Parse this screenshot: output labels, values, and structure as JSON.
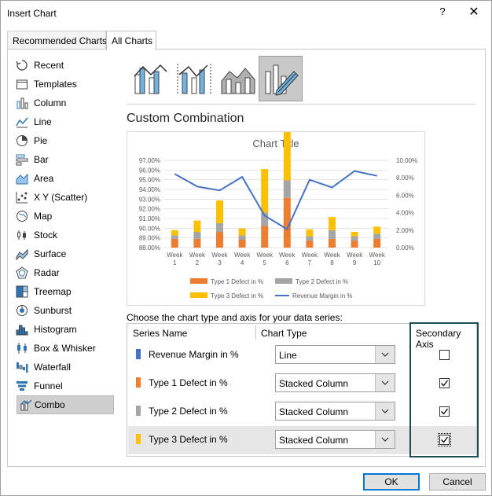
{
  "window": {
    "title": "Insert Chart",
    "help": "?",
    "close": "✕"
  },
  "tabs": [
    {
      "label": "Recommended Charts"
    },
    {
      "label": "All Charts"
    }
  ],
  "sidebar": {
    "items": [
      {
        "label": "Recent",
        "icon": "recent-icon"
      },
      {
        "label": "Templates",
        "icon": "templates-icon"
      },
      {
        "label": "Column",
        "icon": "column-icon"
      },
      {
        "label": "Line",
        "icon": "line-icon"
      },
      {
        "label": "Pie",
        "icon": "pie-icon"
      },
      {
        "label": "Bar",
        "icon": "bar-icon"
      },
      {
        "label": "Area",
        "icon": "area-icon"
      },
      {
        "label": "X Y (Scatter)",
        "icon": "scatter-icon"
      },
      {
        "label": "Map",
        "icon": "map-icon"
      },
      {
        "label": "Stock",
        "icon": "stock-icon"
      },
      {
        "label": "Surface",
        "icon": "surface-icon"
      },
      {
        "label": "Radar",
        "icon": "radar-icon"
      },
      {
        "label": "Treemap",
        "icon": "treemap-icon"
      },
      {
        "label": "Sunburst",
        "icon": "sunburst-icon"
      },
      {
        "label": "Histogram",
        "icon": "histogram-icon"
      },
      {
        "label": "Box & Whisker",
        "icon": "box-whisker-icon"
      },
      {
        "label": "Waterfall",
        "icon": "waterfall-icon"
      },
      {
        "label": "Funnel",
        "icon": "funnel-icon"
      },
      {
        "label": "Combo",
        "icon": "combo-icon",
        "selected": true
      }
    ]
  },
  "main": {
    "heading": "Custom Combination",
    "choose_label": "Choose the chart type and axis for your data series:"
  },
  "chart_data": {
    "type": "bar",
    "title": "Chart Title",
    "categories": [
      "Week 1",
      "Week 2",
      "Week 3",
      "Week 4",
      "Week 5",
      "Week 6",
      "Week 7",
      "Week 8",
      "Week 9",
      "Week 10"
    ],
    "primary_axis_ticks": [
      "97.00%",
      "96.00%",
      "95.00%",
      "94.00%",
      "93.00%",
      "92.00%",
      "91.00%",
      "90.00%",
      "89.00%",
      "88.00%"
    ],
    "secondary_axis_ticks": [
      "10.00%",
      "8.00%",
      "6.00%",
      "4.00%",
      "2.00%",
      "0.00%"
    ],
    "ylim": [
      88,
      97
    ],
    "y2lim": [
      0,
      10
    ],
    "series": [
      {
        "name": "Type 1 Defect in %",
        "kind": "stacked-column",
        "axis": "secondary",
        "color": "#ED7D31",
        "values": [
          1.0,
          1.0,
          1.8,
          0.9,
          2.5,
          5.7,
          0.8,
          1.0,
          0.8,
          1.0
        ]
      },
      {
        "name": "Type 2 Defect in %",
        "kind": "stacked-column",
        "axis": "secondary",
        "color": "#A5A5A5",
        "values": [
          0.4,
          0.8,
          1.0,
          0.5,
          1.5,
          2.0,
          0.5,
          1.0,
          0.5,
          0.6
        ]
      },
      {
        "name": "Type 3 Defect in %",
        "kind": "stacked-column",
        "axis": "secondary",
        "color": "#FFC000",
        "values": [
          0.6,
          1.3,
          2.6,
          0.8,
          5.0,
          6.6,
          0.8,
          1.5,
          0.5,
          0.8
        ]
      },
      {
        "name": "Revenue Margin in %",
        "kind": "line",
        "axis": "primary",
        "color": "#4472C4",
        "values": [
          95.6,
          94.3,
          93.9,
          95.3,
          91.3,
          89.9,
          95.0,
          94.2,
          95.9,
          95.4
        ]
      }
    ],
    "legend": "bottom"
  },
  "series_table": {
    "headers": {
      "name": "Series Name",
      "type": "Chart Type",
      "axis": "Secondary Axis"
    },
    "rows": [
      {
        "name": "Revenue Margin in %",
        "color": "#4472C4",
        "chart_type": "Line",
        "secondary": false
      },
      {
        "name": "Type 1 Defect in %",
        "color": "#ED7D31",
        "chart_type": "Stacked Column",
        "secondary": true
      },
      {
        "name": "Type 2 Defect in %",
        "color": "#A5A5A5",
        "chart_type": "Stacked Column",
        "secondary": true
      },
      {
        "name": "Type 3 Defect in %",
        "color": "#FFC000",
        "chart_type": "Stacked Column",
        "secondary": true,
        "highlighted": true
      }
    ]
  },
  "buttons": {
    "ok": "OK",
    "cancel": "Cancel"
  }
}
